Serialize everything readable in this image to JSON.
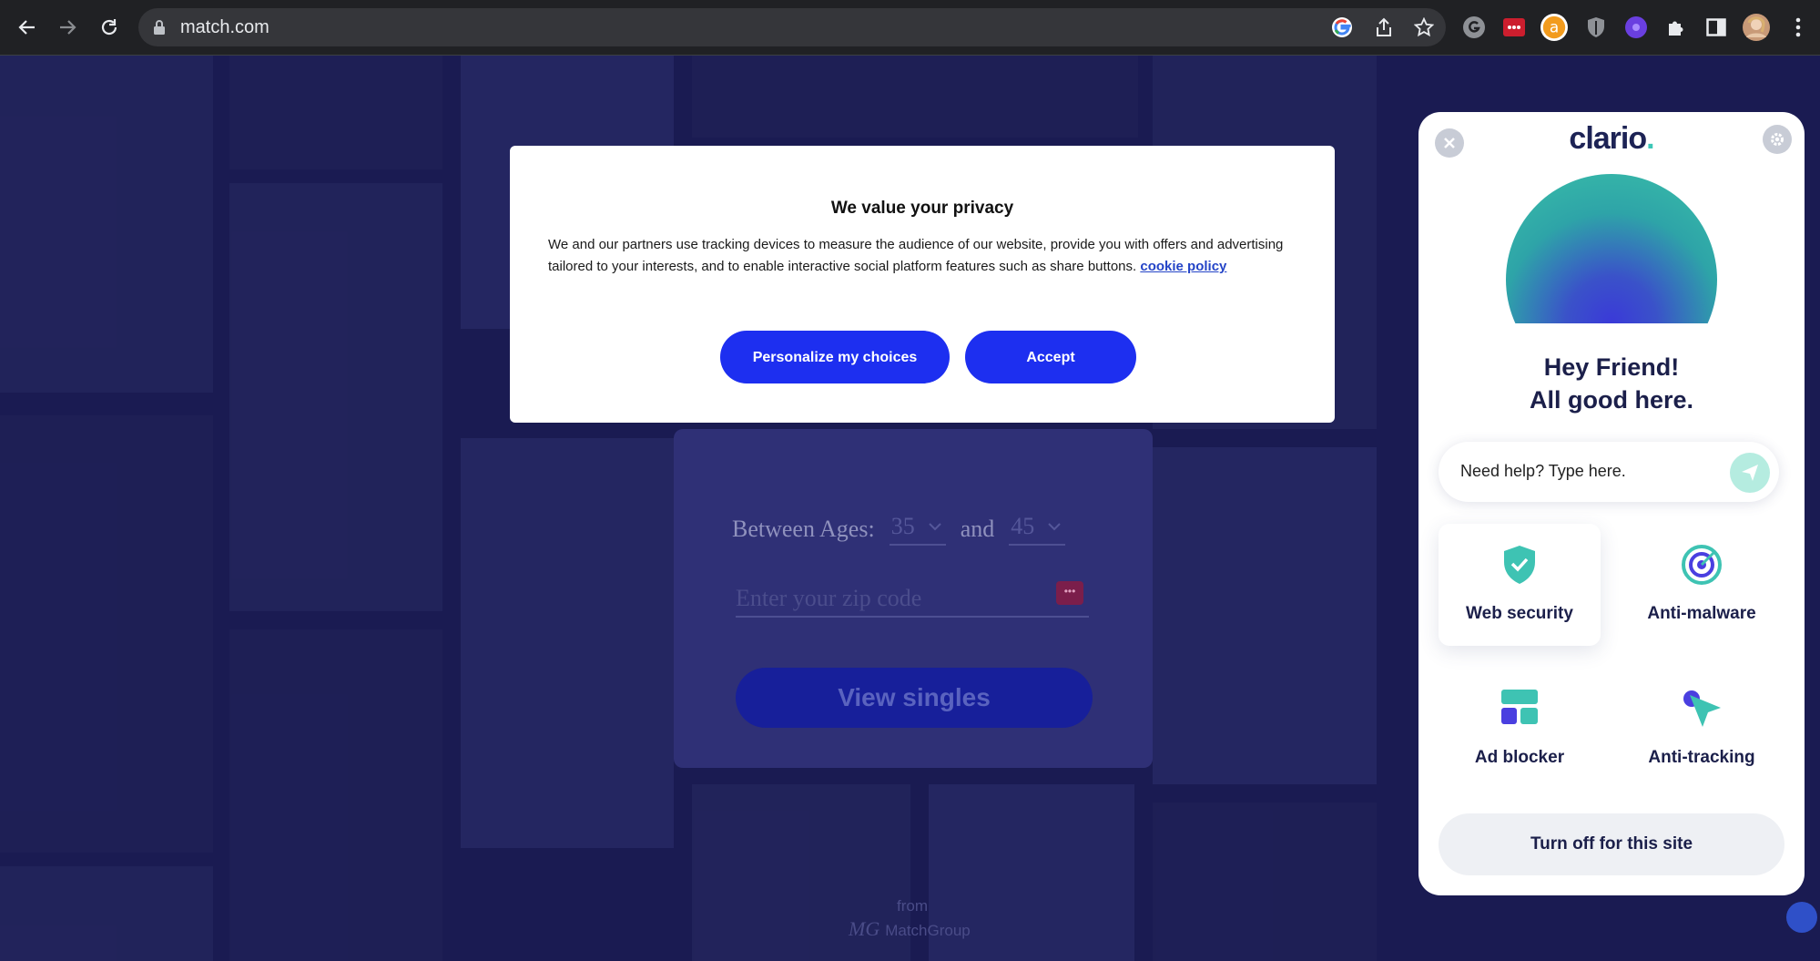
{
  "browser": {
    "url": "match.com",
    "toolbar_icons": [
      "google-icon",
      "share-icon",
      "star-icon"
    ],
    "extensions": [
      "grammarly-extension-icon",
      "lastpass-extension-icon",
      "amazon-assistant-icon",
      "shield-extension-icon",
      "clario-extension-icon",
      "puzzle-extensions-icon",
      "side-panel-icon",
      "profile-avatar",
      "kebab-menu-icon"
    ]
  },
  "page": {
    "search": {
      "between_label": "Between Ages:",
      "age_min": "35",
      "and_label": "and",
      "age_max": "45",
      "zip_placeholder": "Enter your zip code",
      "view_button": "View singles"
    },
    "from_label": "from",
    "brand": "MatchGroup"
  },
  "privacy_modal": {
    "title": "We value your privacy",
    "body": "We and our partners use tracking devices to measure the audience of our website, provide you with offers and advertising tailored to your interests, and to enable interactive social platform features such as share buttons.",
    "link": "cookie policy",
    "personalize_button": "Personalize my choices",
    "accept_button": "Accept"
  },
  "clario": {
    "logo_text": "clario",
    "logo_dot": ".",
    "greeting_line1": "Hey Friend!",
    "greeting_line2": "All good here.",
    "help_placeholder": "Need help? Type here.",
    "features": [
      {
        "label": "Web security",
        "icon": "shield-check-icon",
        "active": true
      },
      {
        "label": "Anti-malware",
        "icon": "radar-icon",
        "active": false
      },
      {
        "label": "Ad blocker",
        "icon": "ad-blocker-icon",
        "active": false
      },
      {
        "label": "Anti-tracking",
        "icon": "anti-tracking-icon",
        "active": false
      }
    ],
    "turn_off_button": "Turn off for this site",
    "colors": {
      "navy": "#1b1f4a",
      "teal": "#3cc7b7",
      "purple": "#4a3fe0"
    }
  }
}
